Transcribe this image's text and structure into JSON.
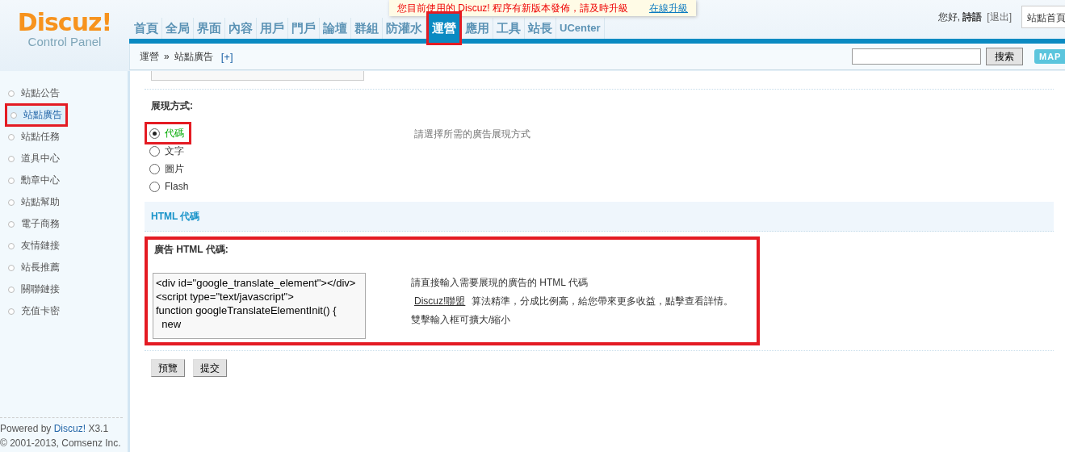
{
  "logo": {
    "title": "Discuz!",
    "subtitle": "Control Panel"
  },
  "notice": {
    "text": "您目前使用的 Discuz! 程序有新版本發佈，請及時升級",
    "link": "在線升級"
  },
  "nav": [
    {
      "label": "首頁",
      "selected": false,
      "highlighted": false
    },
    {
      "label": "全局",
      "selected": false,
      "highlighted": false
    },
    {
      "label": "界面",
      "selected": false,
      "highlighted": false
    },
    {
      "label": "內容",
      "selected": false,
      "highlighted": false
    },
    {
      "label": "用戶",
      "selected": false,
      "highlighted": false
    },
    {
      "label": "門戶",
      "selected": false,
      "highlighted": false
    },
    {
      "label": "論壇",
      "selected": false,
      "highlighted": false
    },
    {
      "label": "群組",
      "selected": false,
      "highlighted": false
    },
    {
      "label": "防灌水",
      "selected": false,
      "highlighted": false
    },
    {
      "label": "運營",
      "selected": true,
      "highlighted": true
    },
    {
      "label": "應用",
      "selected": false,
      "highlighted": false
    },
    {
      "label": "工具",
      "selected": false,
      "highlighted": false
    },
    {
      "label": "站長",
      "selected": false,
      "highlighted": false
    },
    {
      "label": "UCenter",
      "selected": false,
      "highlighted": false
    }
  ],
  "user": {
    "greeting": "您好, **詩語**",
    "logout": "[退出]",
    "site_select": "站點首頁"
  },
  "breadcrumb": {
    "section": "運營",
    "separator": "»",
    "page": "站點廣告",
    "add": "[+]"
  },
  "search": {
    "button": "搜索"
  },
  "map_button": "MAP",
  "sidebar": {
    "items": [
      {
        "label": "站點公告",
        "selected": false,
        "highlighted": false
      },
      {
        "label": "站點廣告",
        "selected": true,
        "highlighted": true
      },
      {
        "label": "站點任務",
        "selected": false,
        "highlighted": false
      },
      {
        "label": "道具中心",
        "selected": false,
        "highlighted": false
      },
      {
        "label": "勳章中心",
        "selected": false,
        "highlighted": false
      },
      {
        "label": "站點幫助",
        "selected": false,
        "highlighted": false
      },
      {
        "label": "電子商務",
        "selected": false,
        "highlighted": false
      },
      {
        "label": "友情鏈接",
        "selected": false,
        "highlighted": false
      },
      {
        "label": "站長推薦",
        "selected": false,
        "highlighted": false
      },
      {
        "label": "關聯鏈接",
        "selected": false,
        "highlighted": false
      },
      {
        "label": "充值卡密",
        "selected": false,
        "highlighted": false
      }
    ],
    "footer": {
      "powered": "Powered by",
      "brand": "Discuz!",
      "version": "X3.1",
      "copyright": "© 2001-2013, Comsenz Inc."
    }
  },
  "form": {
    "display": {
      "label": "展現方式:",
      "hint": "請選擇所需的廣告展現方式",
      "options": [
        {
          "label": "代碼",
          "selected": true,
          "highlighted": true
        },
        {
          "label": "文字",
          "selected": false,
          "highlighted": false
        },
        {
          "label": "圖片",
          "selected": false,
          "highlighted": false
        },
        {
          "label": "Flash",
          "selected": false,
          "highlighted": false
        }
      ]
    },
    "section_title": "HTML 代碼",
    "html_code": {
      "label": "廣告 HTML 代碼:",
      "highlighted": true,
      "value": "<div id=\"google_translate_element\"></div><script type=\"text/javascript\">\nfunction googleTranslateElementInit() {\n  new",
      "hint": "請直接輸入需要展現的廣告的 HTML 代碼",
      "promo_link": "Discuz!聯盟",
      "promo_text": "算法精準，分成比例高，給您帶來更多收益，點擊查看詳情。",
      "resize_hint": "雙擊輸入框可擴大/縮小"
    }
  },
  "buttons": [
    "預覽",
    "提交"
  ]
}
